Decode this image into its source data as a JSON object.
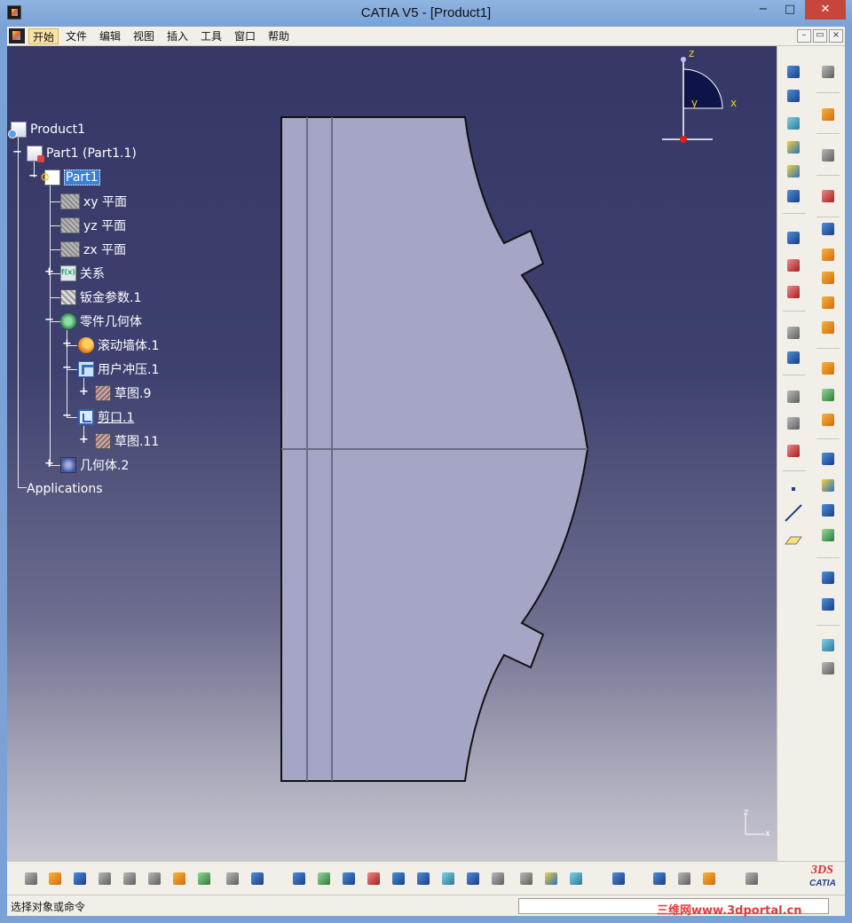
{
  "window": {
    "title": "CATIA V5 - [Product1]",
    "minimize": "−",
    "maximize": "□",
    "close": "✕"
  },
  "menu": {
    "items": [
      "开始",
      "文件",
      "编辑",
      "视图",
      "插入",
      "工具",
      "窗口",
      "帮助"
    ],
    "mdi_minimize": "–",
    "mdi_restore": "▭",
    "mdi_close": "×"
  },
  "tree": {
    "nodes": [
      {
        "label": "Product1",
        "icon": "product-icon"
      },
      {
        "label": "Part1 (Part1.1)",
        "icon": "part-icon"
      },
      {
        "label": "Part1",
        "icon": "part-body-icon",
        "selected": true
      },
      {
        "label": "xy 平面",
        "icon": "plane-icon"
      },
      {
        "label": "yz 平面",
        "icon": "plane-icon"
      },
      {
        "label": "zx 平面",
        "icon": "plane-icon"
      },
      {
        "label": "关系",
        "icon": "relations-icon"
      },
      {
        "label": "钣金参数.1",
        "icon": "sheetmetal-params-icon"
      },
      {
        "label": "零件几何体",
        "icon": "part-body-icon"
      },
      {
        "label": "滚动墙体.1",
        "icon": "rolled-wall-icon"
      },
      {
        "label": "用户冲压.1",
        "icon": "user-stamp-icon"
      },
      {
        "label": "草图.9",
        "icon": "sketch-icon"
      },
      {
        "label": "剪口.1",
        "icon": "cut-out-icon"
      },
      {
        "label": "草图.11",
        "icon": "sketch-icon"
      },
      {
        "label": "几何体.2",
        "icon": "geometric-body-icon"
      },
      {
        "label": "Applications",
        "icon": ""
      }
    ]
  },
  "compass": {
    "z": "z",
    "x": "x",
    "y": "y"
  },
  "axis_mini": {
    "z": "z",
    "x": "x"
  },
  "status": {
    "text": "选择对象或命令",
    "command_value": ""
  },
  "watermark": "三维网www.3dportal.cn",
  "logo": {
    "mark": "3DS",
    "word": "CATIA"
  },
  "colors": {
    "viewport_top": "#353766",
    "viewport_bottom": "#c9c8d2",
    "part_fill": "#a5a5c6",
    "selection": "#3c7fd6"
  }
}
